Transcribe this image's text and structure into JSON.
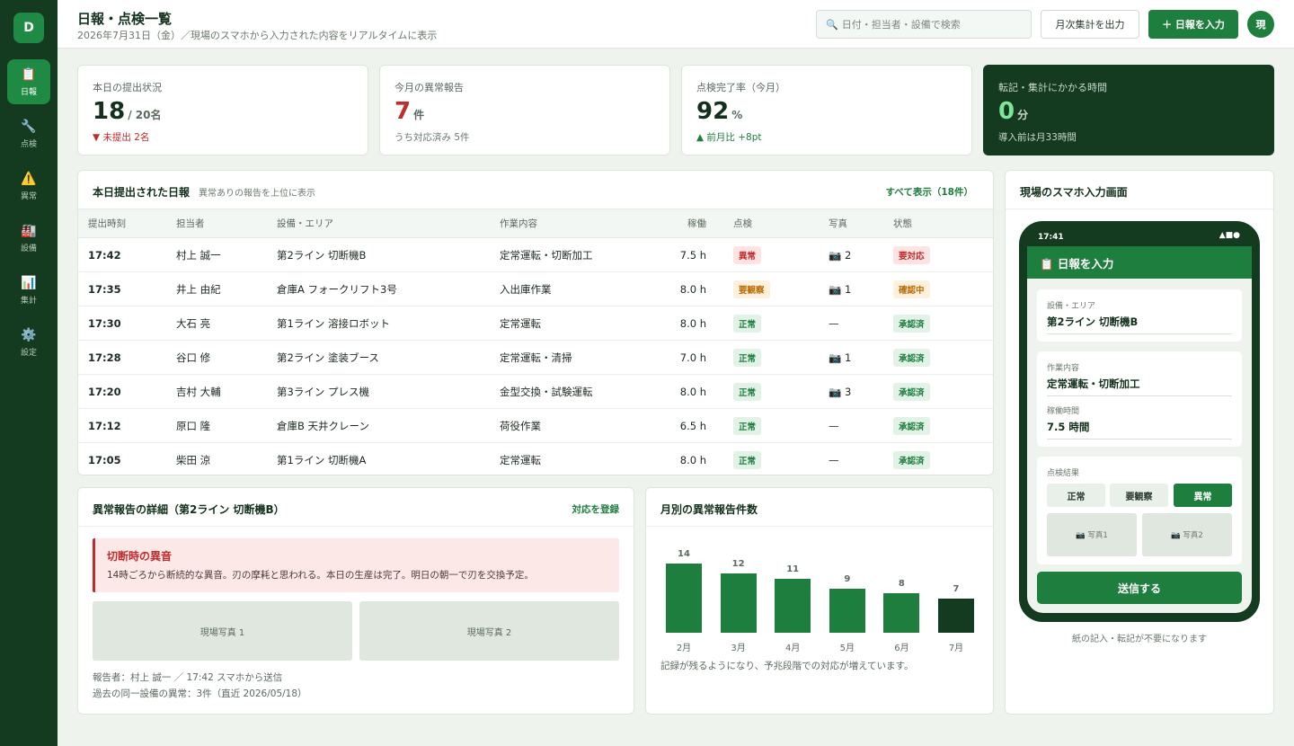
{
  "sidebar": {
    "logo": "D",
    "items": [
      {
        "icon": "📋",
        "label": "日報",
        "icon_name": "clipboard-icon"
      },
      {
        "icon": "🔧",
        "label": "点検",
        "icon_name": "wrench-icon"
      },
      {
        "icon": "⚠️",
        "label": "異常",
        "icon_name": "warning-icon"
      },
      {
        "icon": "🏭",
        "label": "設備",
        "icon_name": "factory-icon"
      },
      {
        "icon": "📊",
        "label": "集計",
        "icon_name": "bar-chart-icon"
      },
      {
        "icon": "⚙️",
        "label": "設定",
        "icon_name": "gear-icon"
      }
    ]
  },
  "header": {
    "title": "日報・点検一覧",
    "subtitle": "2026年7月31日（金）／現場のスマホから入力された内容をリアルタイムに表示",
    "search_icon": "🔍",
    "search_placeholder": "日付・担当者・設備で検索",
    "export_label": "月次集計を出力",
    "new_label": "＋ 日報を入力",
    "avatar": "現"
  },
  "kpis": [
    {
      "label": "本日の提出状況",
      "value": "18",
      "unit": "/ 20名",
      "note": "▼ 未提出 2名",
      "value_color": "#12301b",
      "note_color": "#c22b2b"
    },
    {
      "label": "今月の異常報告",
      "value": "7",
      "unit": "件",
      "note": "うち対応済み 5件",
      "value_color": "#c22b2b",
      "note_color": "#6a786d"
    },
    {
      "label": "点検完了率（今月）",
      "value": "92",
      "unit": "%",
      "note": "▲ 前月比 +8pt",
      "value_color": "#12301b",
      "note_color": "#1e7e3e"
    },
    {
      "label": "転記・集計にかかる時間",
      "value": "0",
      "unit": "分",
      "note": "導入前は月33時間",
      "value_color": "#7ee59a",
      "note_color": "#c8d8cb"
    }
  ],
  "reports": {
    "title": "本日提出された日報",
    "subtitle": "異常ありの報告を上位に表示",
    "show_all": "すべて表示（18件）",
    "columns": [
      "提出時刻",
      "担当者",
      "設備・エリア",
      "作業内容",
      "稼働",
      "点検",
      "写真",
      "状態"
    ],
    "rows": [
      {
        "time": "17:42",
        "person": "村上 誠一",
        "area": "第2ライン 切断機B",
        "work": "定常運転・切断加工",
        "hours": "7.5 h",
        "check": "異常",
        "check_tone": "red",
        "photo": "📷 2",
        "status": "要対応",
        "status_tone": "red"
      },
      {
        "time": "17:35",
        "person": "井上 由紀",
        "area": "倉庫A フォークリフト3号",
        "work": "入出庫作業",
        "hours": "8.0 h",
        "check": "要観察",
        "check_tone": "amber",
        "photo": "📷 1",
        "status": "確認中",
        "status_tone": "amber"
      },
      {
        "time": "17:30",
        "person": "大石 亮",
        "area": "第1ライン 溶接ロボット",
        "work": "定常運転",
        "hours": "8.0 h",
        "check": "正常",
        "check_tone": "green",
        "photo": "—",
        "status": "承認済",
        "status_tone": "green"
      },
      {
        "time": "17:28",
        "person": "谷口 修",
        "area": "第2ライン 塗装ブース",
        "work": "定常運転・清掃",
        "hours": "7.0 h",
        "check": "正常",
        "check_tone": "green",
        "photo": "📷 1",
        "status": "承認済",
        "status_tone": "green"
      },
      {
        "time": "17:20",
        "person": "吉村 大輔",
        "area": "第3ライン プレス機",
        "work": "金型交換・試験運転",
        "hours": "8.0 h",
        "check": "正常",
        "check_tone": "green",
        "photo": "📷 3",
        "status": "承認済",
        "status_tone": "green"
      },
      {
        "time": "17:12",
        "person": "原口 隆",
        "area": "倉庫B 天井クレーン",
        "work": "荷役作業",
        "hours": "6.5 h",
        "check": "正常",
        "check_tone": "green",
        "photo": "—",
        "status": "承認済",
        "status_tone": "green"
      },
      {
        "time": "17:05",
        "person": "柴田 涼",
        "area": "第1ライン 切断機A",
        "work": "定常運転",
        "hours": "8.0 h",
        "check": "正常",
        "check_tone": "green",
        "photo": "—",
        "status": "承認済",
        "status_tone": "green"
      }
    ]
  },
  "anomaly": {
    "title": "異常報告の詳細（第2ライン 切断機B）",
    "action": "対応を登録",
    "alert_title": "切断時の異音",
    "alert_body": "14時ごろから断続的な異音。刃の摩耗と思われる。本日の生産は完了。明日の朝一で刃を交換予定。",
    "photo1": "現場写真 1",
    "photo2": "現場写真 2",
    "reporter": "報告者：村上 誠一 ／ 17:42 スマホから送信",
    "history": "過去の同一設備の異常：3件（直近 2026/05/18）"
  },
  "chart_data": {
    "type": "bar",
    "title": "月別の異常報告件数",
    "categories": [
      "2月",
      "3月",
      "4月",
      "5月",
      "6月",
      "7月"
    ],
    "values": [
      14,
      12,
      11,
      9,
      8,
      7
    ],
    "colors": [
      "#1e7e3e",
      "#1e7e3e",
      "#1e7e3e",
      "#1e7e3e",
      "#1e7e3e",
      "#143a20"
    ],
    "note": "記録が残るようになり、予兆段階での対応が増えています。"
  },
  "phone_panel": {
    "title": "現場のスマホ入力画面",
    "time": "17:41",
    "status_icons": "▲■●",
    "header": "📋 日報を入力",
    "area_label": "設備・エリア",
    "area_value": "第2ライン 切断機B",
    "work_label": "作業内容",
    "work_value": "定常運転・切断加工",
    "hours_label": "稼働時間",
    "hours_value": "7.5 時間",
    "check_label": "点検結果",
    "options": [
      "正常",
      "要観察",
      "異常"
    ],
    "photo1": "📷 写真1",
    "photo2": "📷 写真2",
    "send": "送信する",
    "caption": "紙の記入・転記が不要になります"
  }
}
